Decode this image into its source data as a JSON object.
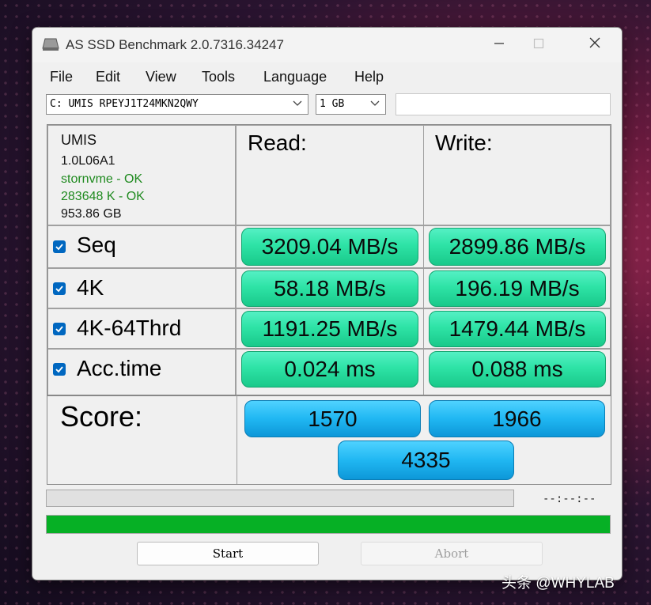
{
  "window": {
    "title": "AS SSD Benchmark 2.0.7316.34247"
  },
  "menu": [
    "File",
    "Edit",
    "View",
    "Tools",
    "Language",
    "Help"
  ],
  "drive_select": {
    "value": "C: UMIS RPEYJ1T24MKN2QWY"
  },
  "size_select": {
    "value": "1 GB"
  },
  "drive_info": {
    "vendor": "UMIS",
    "firmware": "1.0L06A1",
    "driver": "stornvme - OK",
    "alignment": "283648 K - OK",
    "capacity": "953.86 GB"
  },
  "headers": {
    "read": "Read:",
    "write": "Write:"
  },
  "rows": [
    {
      "label": "Seq",
      "read": "3209.04 MB/s",
      "write": "2899.86 MB/s"
    },
    {
      "label": "4K",
      "read": "58.18 MB/s",
      "write": "196.19 MB/s"
    },
    {
      "label": "4K-64Thrd",
      "read": "1191.25 MB/s",
      "write": "1479.44 MB/s"
    },
    {
      "label": "Acc.time",
      "read": "0.024 ms",
      "write": "0.088 ms"
    }
  ],
  "score": {
    "label": "Score:",
    "read": "1570",
    "write": "1966",
    "total": "4335"
  },
  "progress": {
    "time_text": "--:--:--",
    "percent": 100
  },
  "buttons": {
    "start": "Start",
    "abort": "Abort"
  },
  "watermark": "头条 @WHYLAB",
  "colors": {
    "result_green": "#2ee3a6",
    "score_blue": "#20b7f2",
    "progress_green": "#06b025",
    "checkbox_blue": "#0067c0"
  },
  "icons": {
    "close": "close-icon",
    "minimize": "minimize-icon",
    "maximize": "maximize-icon",
    "dropdown": "chevron-down-icon",
    "check": "checkmark-icon"
  }
}
